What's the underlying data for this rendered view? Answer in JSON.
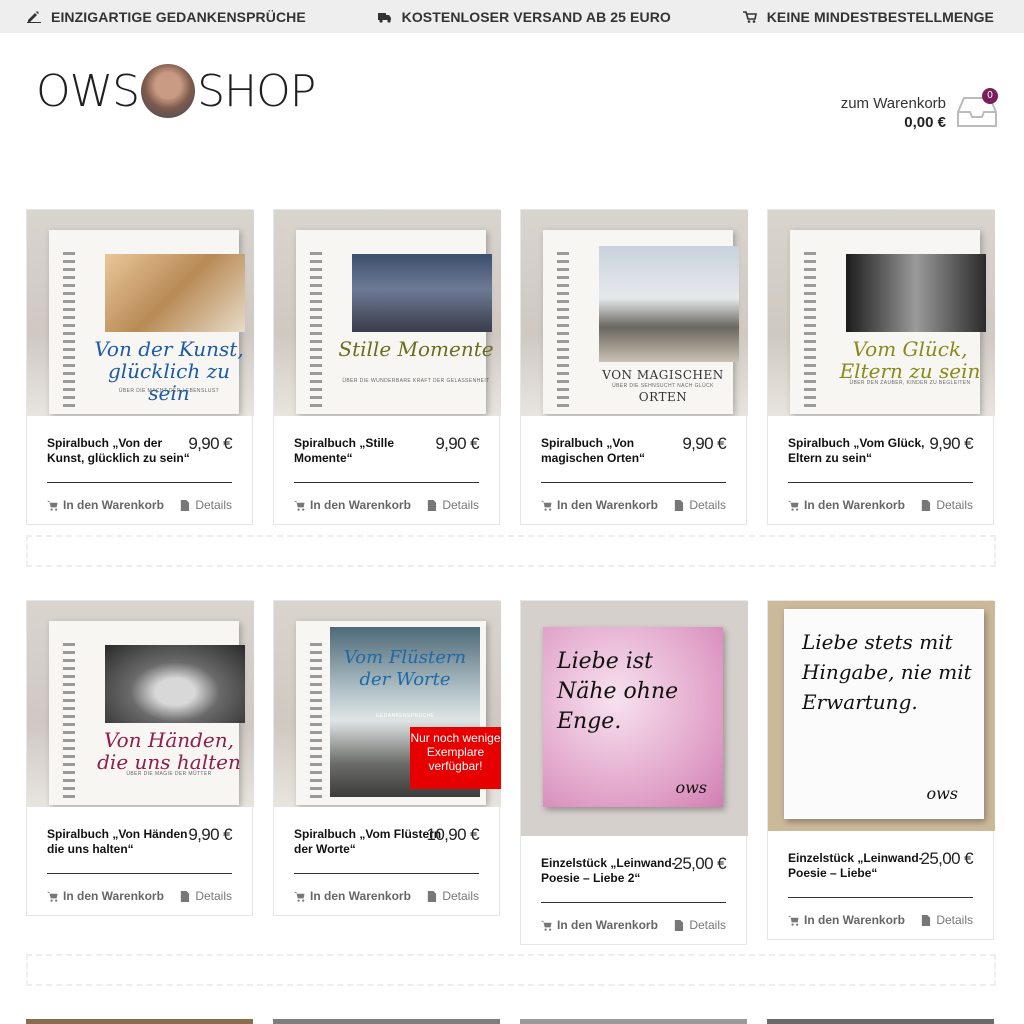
{
  "topbar": {
    "usp1": "EINZIGARTIGE GEDANKENSPRÜCHE",
    "usp2": "KOSTENLOSER VERSAND AB 25 EURO",
    "usp3": "KEINE MINDESTBESTELLMENGE"
  },
  "logo": {
    "left": "OWS",
    "right": "SHOP"
  },
  "cart": {
    "label": "zum Warenkorb",
    "total": "0,00 €",
    "count": "0"
  },
  "actions": {
    "add": "In den Warenkorb",
    "details": "Details"
  },
  "products": [
    {
      "title": "Spiralbuch „Von der Kunst, glücklich zu sein“",
      "price": "9,90 €",
      "cover_title": "Von der Kunst, glücklich zu sein",
      "cover_sub": "ÜBER DIE MACHT DER LEBENSLUST",
      "cover_color": "#1d5aa8"
    },
    {
      "title": "Spiralbuch „Stille Momente“",
      "price": "9,90 €",
      "cover_title": "Stille Momente",
      "cover_sub": "ÜBER DIE WUNDERBARE KRAFT DER GELASSENHEIT",
      "cover_color": "#6b6e1e"
    },
    {
      "title": "Spiralbuch „Von magischen Orten“",
      "price": "9,90 €",
      "cover_title": "VON MAGISCHEN ORTEN",
      "cover_sub": "ÜBER DIE SEHNSUCHT NACH GLÜCK",
      "cover_color": "#333333"
    },
    {
      "title": "Spiralbuch „Vom Glück, Eltern zu sein“",
      "price": "9,90 €",
      "cover_title": "Vom Glück, Eltern zu sein",
      "cover_sub": "ÜBER DEN ZAUBER, KINDER ZU BEGLEITEN",
      "cover_color": "#8a8a1a"
    },
    {
      "title": "Spiralbuch „Von Händen die uns halten“",
      "price": "9,90 €",
      "cover_title": "Von Händen, die uns halten",
      "cover_sub": "ÜBER DIE MAGIE DER MÜTTER",
      "cover_color": "#8e1e4e"
    },
    {
      "title": "Spiralbuch „Vom Flüstern der Worte“",
      "price": "10,90 €",
      "cover_title": "Vom Flüstern der Worte",
      "cover_sub": "GEDANKENSPRÜCHE",
      "cover_color": "#1e6aa8",
      "badge": "Nur noch wenige Exemplare verfügbar!"
    },
    {
      "title": "Einzelstück „Leinwand-Poesie – Liebe 2“",
      "price": "25,00 €",
      "canvas_text": "Liebe ist Nähe ohne Enge.",
      "canvas_sign": "ows"
    },
    {
      "title": "Einzelstück „Leinwand-Poesie – Liebe“",
      "price": "25,00 €",
      "canvas_text": "Liebe stets mit Hingabe, nie mit Erwartung.",
      "canvas_sign": "ows"
    }
  ]
}
